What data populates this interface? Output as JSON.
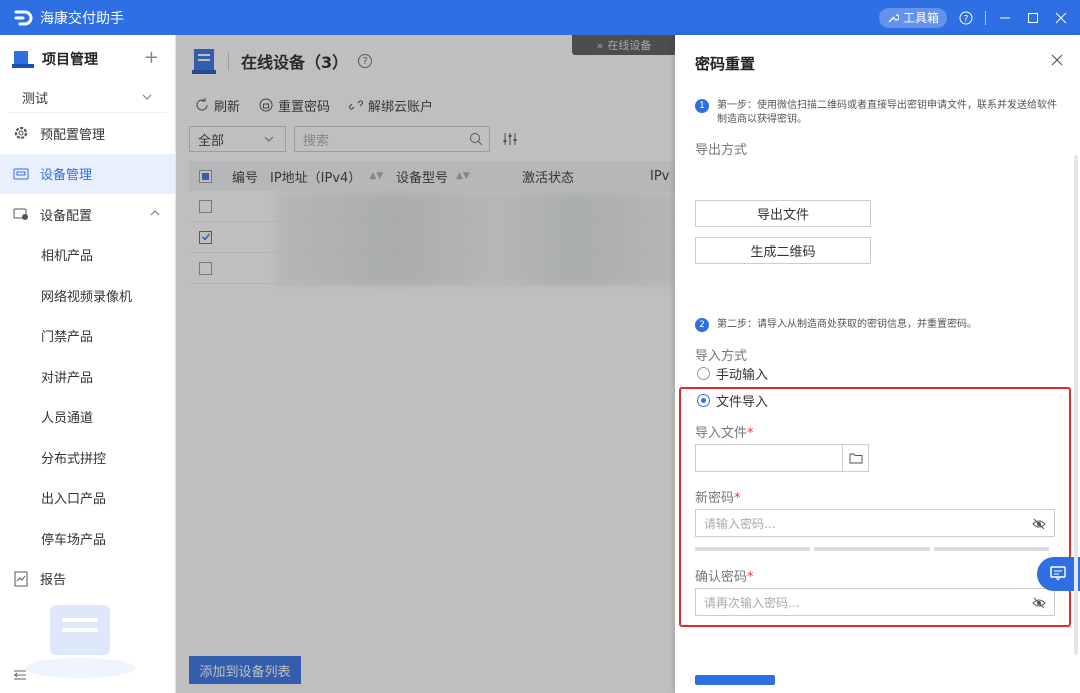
{
  "titlebar": {
    "app_title": "海康交付助手",
    "toolbox_label": "工具箱"
  },
  "sidebar": {
    "project_title": "项目管理",
    "project_select": "测试",
    "items": [
      {
        "label": "预配置管理",
        "icon": "settings-icon"
      },
      {
        "label": "设备管理",
        "icon": "device-icon"
      },
      {
        "label": "设备配置",
        "icon": "device-config-icon"
      },
      {
        "label": "相机产品"
      },
      {
        "label": "网络视频录像机"
      },
      {
        "label": "门禁产品"
      },
      {
        "label": "对讲产品"
      },
      {
        "label": "人员通道"
      },
      {
        "label": "分布式拼控"
      },
      {
        "label": "出入口产品"
      },
      {
        "label": "停车场产品"
      },
      {
        "label": "报告",
        "icon": "report-icon"
      }
    ]
  },
  "main": {
    "online_tab": "在线设备",
    "page_title": "在线设备（3）",
    "toolbar": {
      "refresh": "刷新",
      "reset_password": "重置密码",
      "unbind_cloud": "解绑云账户"
    },
    "filter": {
      "select_value": "全部",
      "search_placeholder": "搜索"
    },
    "table": {
      "columns": [
        "编号",
        "IP地址（IPv4）",
        "设备型号",
        "激活状态",
        "IPv"
      ]
    },
    "add_button": "添加到设备列表"
  },
  "drawer": {
    "title": "密码重置",
    "step1_num": "1",
    "step1_text": "第一步：使用微信扫描二维码或者直接导出密钥申请文件，联系并发送给软件制造商以获得密钥。",
    "export_label": "导出方式",
    "export_file_button": "导出文件",
    "qrcode_button": "生成二维码",
    "step2_num": "2",
    "step2_text": "第二步：请导入从制造商处获取的密钥信息，并重置密码。",
    "import_label": "导入方式",
    "radio_manual": "手动输入",
    "radio_file": "文件导入",
    "import_file_label": "导入文件",
    "new_password_label": "新密码",
    "new_password_placeholder": "请输入密码...",
    "confirm_password_label": "确认密码",
    "confirm_password_placeholder": "请再次输入密码...",
    "required_mark": "*"
  },
  "colors": {
    "accent": "#2f6fe4",
    "highlight_box": "#e42b2b"
  }
}
